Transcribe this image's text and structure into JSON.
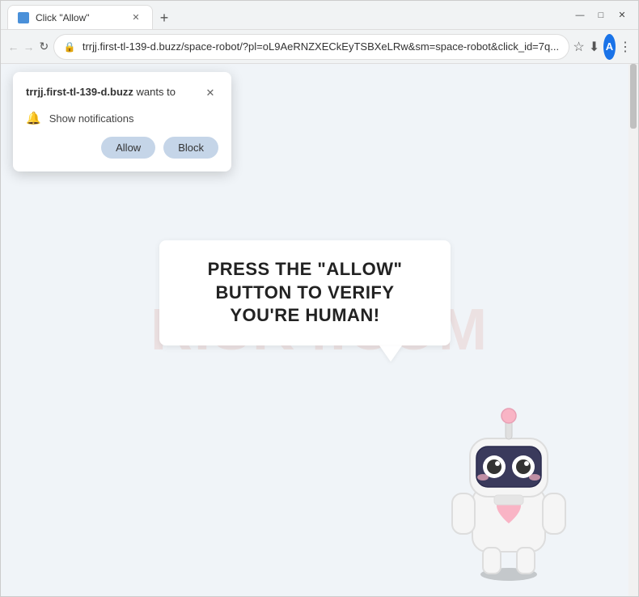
{
  "browser": {
    "tab": {
      "title": "Click \"Allow\""
    },
    "address": "trrjj.first-tl-139-d.buzz/space-robot/?pl=oL9AeRNZXECkEyTSBXeLRw&sm=space-robot&click_id=7q...",
    "new_tab_label": "+",
    "window_controls": {
      "minimize": "—",
      "maximize": "□",
      "close": "✕"
    },
    "nav": {
      "back": "←",
      "forward": "→",
      "reload": "↻"
    },
    "icons": {
      "star": "☆",
      "download": "⬇",
      "menu": "⋮"
    }
  },
  "notification_popup": {
    "title_bold": "trrjj.first-tl-139-d.buzz",
    "title_rest": " wants to",
    "notification_text": "Show notifications",
    "allow_label": "Allow",
    "block_label": "Block",
    "close_symbol": "✕"
  },
  "page": {
    "speech_bubble_line1": "PRESS THE \"ALLOW\" BUTTON TO VERIFY",
    "speech_bubble_line2": "YOU'RE HUMAN!",
    "watermark": "RISK4.COM"
  }
}
